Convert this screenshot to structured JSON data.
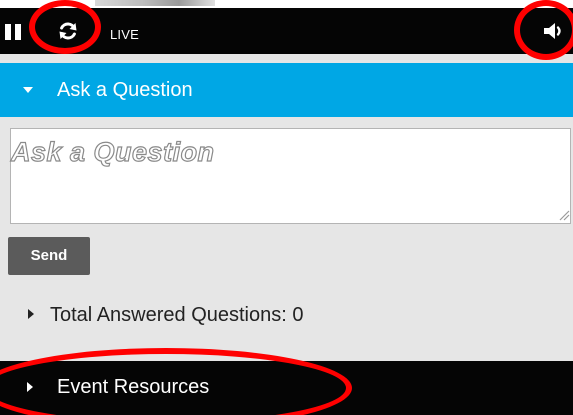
{
  "player": {
    "status_label": "LIVE",
    "icons": {
      "pause": "pause-icon",
      "refresh": "refresh-icon",
      "volume": "volume-icon"
    }
  },
  "ask_section": {
    "title": "Ask a Question",
    "placeholder": "Ask a Question",
    "send_label": "Send"
  },
  "answered": {
    "label": "Total Answered Questions: 0"
  },
  "resources": {
    "label": "Event Resources"
  },
  "colors": {
    "player_bar": "#050505",
    "accent_blue": "#00a7e5",
    "send_button": "#5b5b5b",
    "panel_background": "#e6e6e6",
    "annotation_red": "#ff0000"
  },
  "annotations": [
    "refresh-button",
    "volume-button",
    "event-resources"
  ]
}
